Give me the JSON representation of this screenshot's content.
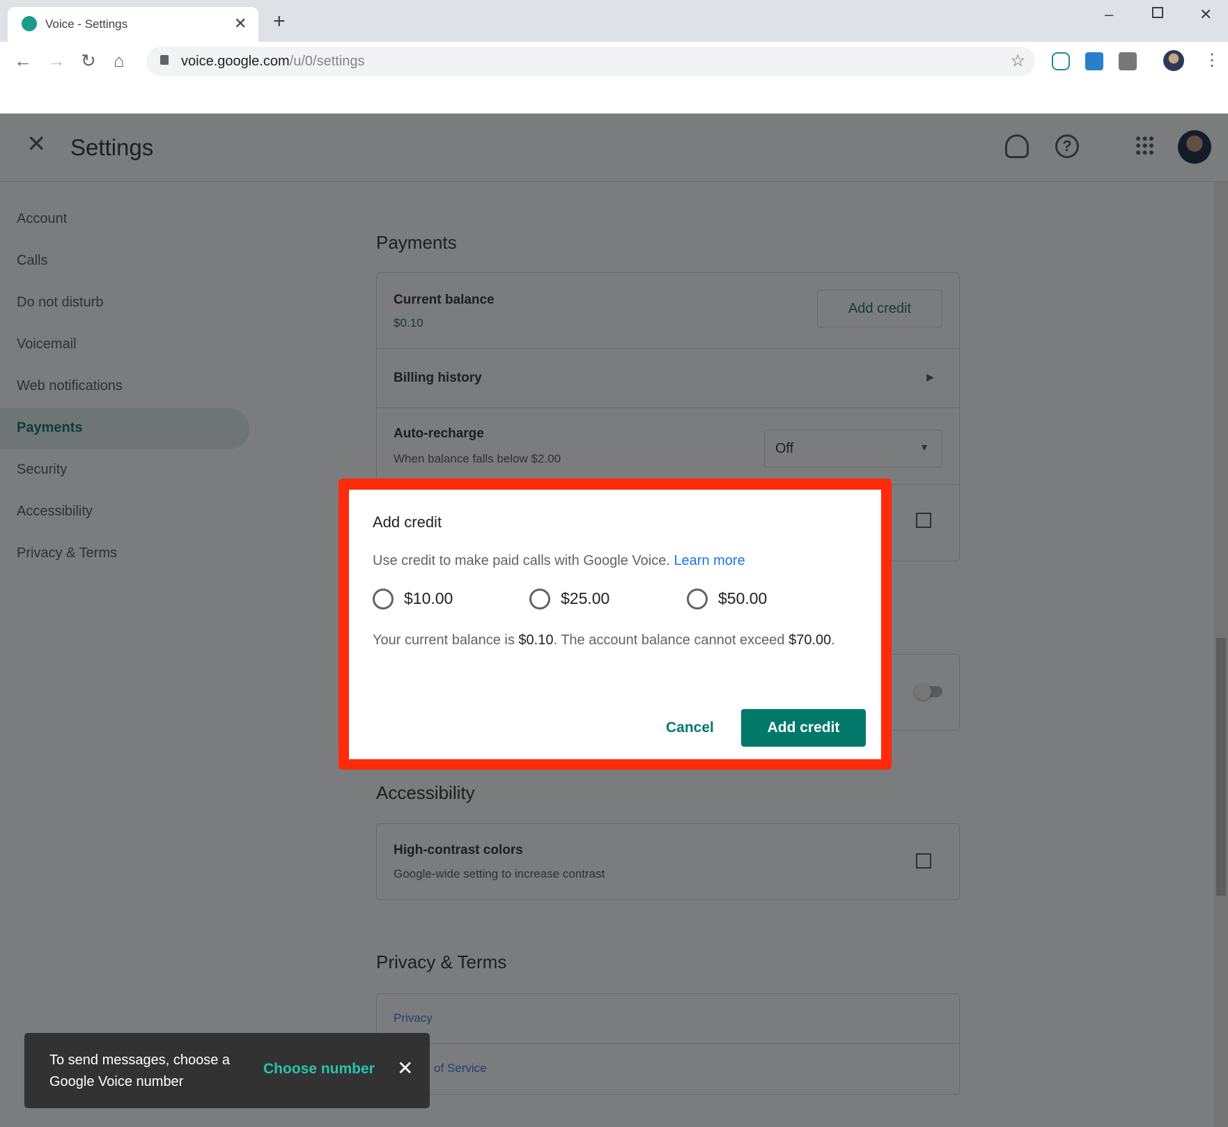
{
  "browser": {
    "tab_title": "Voice - Settings",
    "url_host": "voice.google.com",
    "url_path": "/u/0/settings"
  },
  "app": {
    "title": "Settings"
  },
  "sidebar": {
    "items": [
      {
        "label": "Account"
      },
      {
        "label": "Calls"
      },
      {
        "label": "Do not disturb"
      },
      {
        "label": "Voicemail"
      },
      {
        "label": "Web notifications"
      },
      {
        "label": "Payments"
      },
      {
        "label": "Security"
      },
      {
        "label": "Accessibility"
      },
      {
        "label": "Privacy & Terms"
      }
    ],
    "active": "Payments"
  },
  "payments": {
    "heading": "Payments",
    "balance_label": "Current balance",
    "balance_value": "$0.10",
    "add_credit": "Add credit",
    "billing_history": "Billing history",
    "auto_recharge": "Auto-recharge",
    "auto_recharge_sub": "When balance falls below $2.00",
    "auto_recharge_value": "Off"
  },
  "accessibility": {
    "heading": "Accessibility",
    "high_contrast": "High-contrast colors",
    "high_contrast_sub": "Google-wide setting to increase contrast"
  },
  "privacy": {
    "heading": "Privacy & Terms",
    "privacy": "Privacy",
    "tos": "of Service"
  },
  "dialog": {
    "title": "Add credit",
    "description": "Use credit to make paid calls with Google Voice.",
    "learn_more": "Learn more",
    "options": [
      "$10.00",
      "$25.00",
      "$50.00"
    ],
    "balance_prefix": "Your current balance is",
    "balance": "$0.10",
    "balance_suffix": ". The account balance cannot exceed",
    "max": "$70.00",
    "max_suffix": ".",
    "cancel": "Cancel",
    "confirm": "Add credit"
  },
  "toast": {
    "message": "To send messages, choose a Google Voice number",
    "action": "Choose number"
  },
  "colors": {
    "accent": "#00796b",
    "highlight": "#ff2a0a"
  }
}
